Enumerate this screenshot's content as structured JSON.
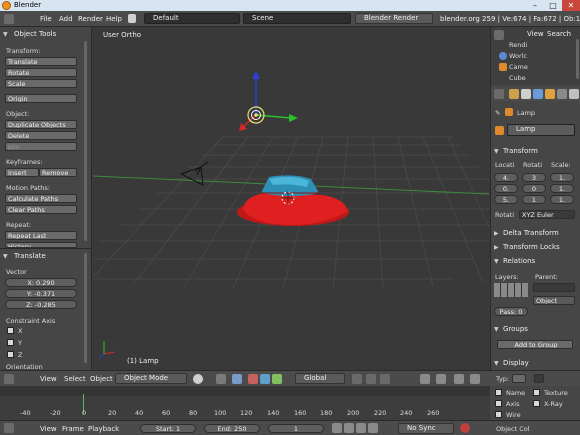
{
  "window": {
    "title": "Blender"
  },
  "topbar": {
    "menu": [
      "File",
      "Add",
      "Render",
      "Help"
    ],
    "layout": "Default",
    "scene": "Scene",
    "engine": "Blender Render",
    "info": "blender.org 259 | Ve:674 | Fa:672 | Ob:1-3 | La:"
  },
  "tools": {
    "title": "Object Tools",
    "transform_label": "Transform:",
    "translate": "Translate",
    "rotate": "Rotate",
    "scale": "Scale",
    "origin": "Origin",
    "object_label": "Object:",
    "duplicate": "Duplicate Objects",
    "delete": "Delete",
    "join": "Join",
    "keyframes_label": "Keyframes:",
    "insert": "Insert",
    "remove": "Remove",
    "motion_label": "Motion Paths:",
    "calc_paths": "Calculate Paths",
    "clear_paths": "Clear Paths",
    "repeat_label": "Repeat:",
    "repeat_last": "Repeat Last",
    "history": "History..."
  },
  "operator": {
    "title": "Translate",
    "vector_label": "Vector",
    "x": "X: 0.290",
    "y": "Y: -0.371",
    "z": "Z: -0.285",
    "constraint_label": "Constraint Axis",
    "cx": "X",
    "cy": "Y",
    "cz": "Z",
    "orientation": "Orientation"
  },
  "viewport": {
    "label": "User Ortho",
    "object_label": "(1) Lamp"
  },
  "outliner": {
    "view": "View",
    "search": "Search",
    "items": [
      "Rendi",
      "Worlc",
      "Came",
      "Cube"
    ]
  },
  "properties": {
    "context": "Lamp",
    "object_name": "Lamp",
    "transform": "Transform",
    "loc_label": "Locati",
    "rot_label": "Rotati",
    "scale_label": "Scale:",
    "loc": [
      "4.",
      "0.",
      "5."
    ],
    "rot": [
      "3",
      "0",
      "1"
    ],
    "scl": [
      "1.",
      "1.",
      "1."
    ],
    "rot_mode_label": "Rotati",
    "rot_mode": "XYZ Euler",
    "delta": "Delta Transform",
    "locks": "Transform Locks",
    "relations": "Relations",
    "layers_label": "Layers:",
    "parent_label": "Parent:",
    "parent_type": "Object",
    "pass": "Pass: 0",
    "groups": "Groups",
    "add_group": "Add to Group",
    "display": "Display",
    "type_label": "Typ:",
    "name": "Name",
    "axis": "Axis",
    "wire": "Wire",
    "texture": "Texture",
    "xray": "X-Ray",
    "object_color": "Object Col"
  },
  "view_header": {
    "view": "View",
    "select": "Select",
    "object": "Object",
    "mode": "Object Mode",
    "orientation": "Global"
  },
  "timeline": {
    "ticks": [
      "-40",
      "-20",
      "0",
      "20",
      "40",
      "60",
      "80",
      "100",
      "120",
      "140",
      "160",
      "180",
      "200",
      "220",
      "240",
      "260"
    ],
    "view": "View",
    "frame": "Frame",
    "playback": "Playback",
    "start": "Start: 1",
    "end": "End: 250",
    "current": "1",
    "sync": "No Sync"
  }
}
